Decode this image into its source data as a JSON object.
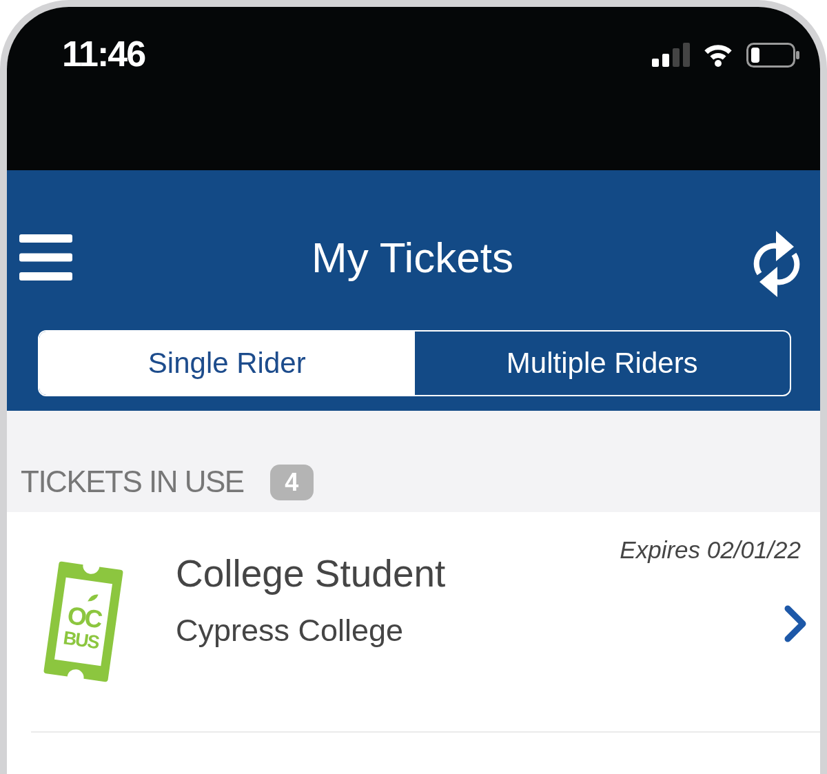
{
  "status_bar": {
    "time": "11:46"
  },
  "header": {
    "title": "My Tickets"
  },
  "tabs": [
    {
      "label": "Single Rider",
      "selected": true
    },
    {
      "label": "Multiple Riders",
      "selected": false
    }
  ],
  "section": {
    "title": "TICKETS IN USE",
    "count": "4"
  },
  "tickets": [
    {
      "logo": [
        "OC",
        "BUS"
      ],
      "name": "College Student",
      "subtitle": "Cypress College",
      "expires": "Expires 02/01/22"
    }
  ]
}
